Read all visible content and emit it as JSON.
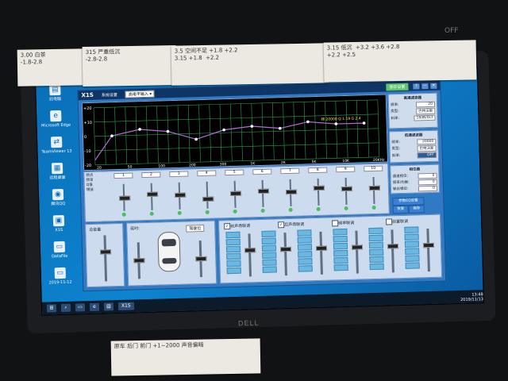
{
  "notes": {
    "a": "3.00 白茶\n-1.8-2.8",
    "b": "315 严重低沉\n-2.8-2.8",
    "c": "3.5 空间不足 +1.8 +2.2\n3.15 +1.8  +2.2",
    "d": "3.15 低沉  +3.2 +3.6 +2.8\n+2.2 +2.5",
    "bottom": "原车 后门 前门 +1~2000 声音偏暗"
  },
  "top_mark": "OFF",
  "laptop_brand": "DELL",
  "desktop_icons": [
    {
      "label": "此电脑",
      "glyph": "▤"
    },
    {
      "label": "Microsoft Edge",
      "glyph": "e"
    },
    {
      "label": "TeamViewer 13",
      "glyph": "⇄"
    },
    {
      "label": "远程桌面",
      "glyph": "▦"
    },
    {
      "label": "腾讯QQ",
      "glyph": "◉"
    },
    {
      "label": "X1S",
      "glyph": "▣"
    },
    {
      "label": "DataFile",
      "glyph": "▭"
    },
    {
      "label": "2019-11-12",
      "glyph": "▭"
    }
  ],
  "taskbar": {
    "window_label": "X1S",
    "time": "13:48",
    "date": "2019/11/13"
  },
  "app": {
    "logo": "X1S",
    "tabs": [
      "系统设置"
    ],
    "input_select": "高电平输入",
    "save_button": "保存设置",
    "window_controls": [
      "?",
      "—",
      "✕"
    ]
  },
  "graph": {
    "y_ticks": [
      "+20",
      "+10",
      "0",
      "-10",
      "-20"
    ],
    "x_ticks": [
      "20",
      "50",
      "100",
      "200",
      "300",
      "1K",
      "2K",
      "5K",
      "10K",
      "20KHz"
    ],
    "readout": "频 20000 Q 1.19 G 2.4"
  },
  "highpass": {
    "title": "高通滤波器",
    "freq_label": "频率:",
    "freq_value": "20",
    "type_label": "类型:",
    "type_value": "巴特沃斯",
    "slope_label": "斜率:",
    "slope_value": "18dB/Oct"
  },
  "lowpass": {
    "title": "低通滤波器",
    "freq_label": "频率:",
    "freq_value": "20000",
    "type_label": "类型:",
    "type_value": "巴特沃斯",
    "slope_label": "斜率:",
    "slope_value": "OFF"
  },
  "phase_panel": {
    "title": "相位器",
    "rows": [
      {
        "label": "通道相位:",
        "value": "0"
      },
      {
        "label": "频率/均衡:",
        "value": "0"
      },
      {
        "label": "输出相位:",
        "value": "0"
      }
    ]
  },
  "strip": {
    "row_labels": [
      "频点",
      "频率",
      "Q值",
      "增益"
    ],
    "bands": [
      {
        "num": "1",
        "gain": 0
      },
      {
        "num": "2",
        "gain": 2
      },
      {
        "num": "3",
        "gain": 1
      },
      {
        "num": "4",
        "gain": -2
      },
      {
        "num": "5",
        "gain": 1
      },
      {
        "num": "6",
        "gain": 2
      },
      {
        "num": "7",
        "gain": 1
      },
      {
        "num": "8",
        "gain": 3
      },
      {
        "num": "9",
        "gain": 2
      },
      {
        "num": "10",
        "gain": 2
      }
    ],
    "buttons": [
      "参数EQ设置",
      "恢复",
      "保存"
    ]
  },
  "master": {
    "label": "总音量"
  },
  "delay": {
    "label": "延时:",
    "value": "驾驶位"
  },
  "mixer": {
    "checks": [
      {
        "label": "前声场联调",
        "checked": true
      },
      {
        "label": "后声场联调",
        "checked": true
      },
      {
        "label": "频率联调",
        "checked": false
      },
      {
        "label": "前置联调",
        "checked": false
      }
    ],
    "columns": 6
  }
}
